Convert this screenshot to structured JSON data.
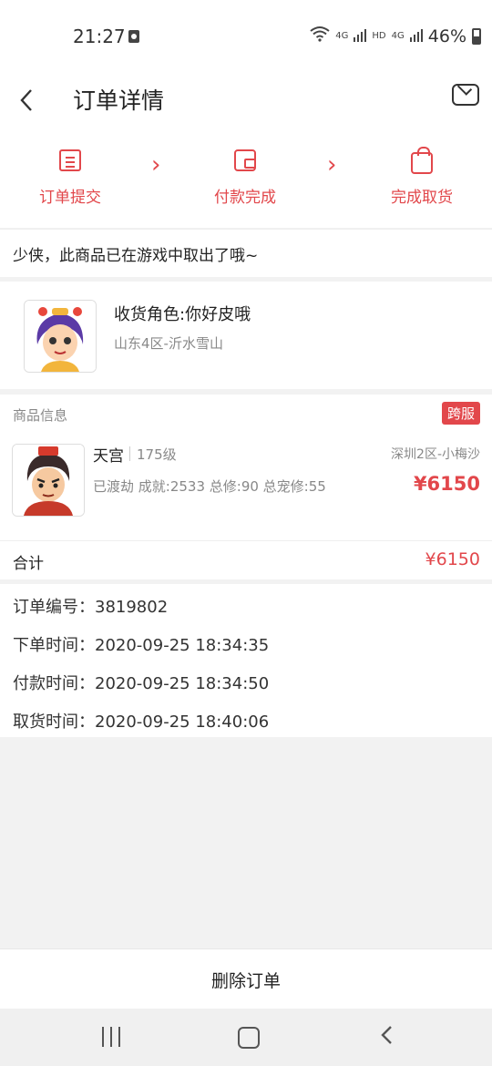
{
  "status_bar": {
    "time": "21:27",
    "net1": "4G",
    "hd": "HD",
    "net2": "4G",
    "battery": "46%"
  },
  "header": {
    "title": "订单详情"
  },
  "steps": [
    {
      "label": "订单提交",
      "icon": "order-doc-icon"
    },
    {
      "label": "付款完成",
      "icon": "wallet-icon"
    },
    {
      "label": "完成取货",
      "icon": "bag-icon"
    }
  ],
  "step_arrow": "›",
  "notice": "少侠，此商品已在游戏中取出了哦~",
  "receiver": {
    "role": "收货角色:你好皮哦",
    "server": "山东4区-沂水雪山"
  },
  "goods": {
    "section_title": "商品信息",
    "badge": "跨服",
    "name": "天宫",
    "level": "175级",
    "zone": "深圳2区-小梅沙",
    "stats": "已渡劫 成就:2533 总修:90 总宠修:55",
    "price": "¥6150"
  },
  "total": {
    "label": "合计",
    "amount": "¥6150"
  },
  "order_info": {
    "order_no": "订单编号：3819802",
    "order_time": "下单时间：2020-09-25 18:34:35",
    "pay_time": "付款时间：2020-09-25 18:34:50",
    "pickup_time": "取货时间：2020-09-25 18:40:06"
  },
  "actions": {
    "delete_label": "删除订单"
  },
  "colors": {
    "accent": "#e2474b"
  }
}
